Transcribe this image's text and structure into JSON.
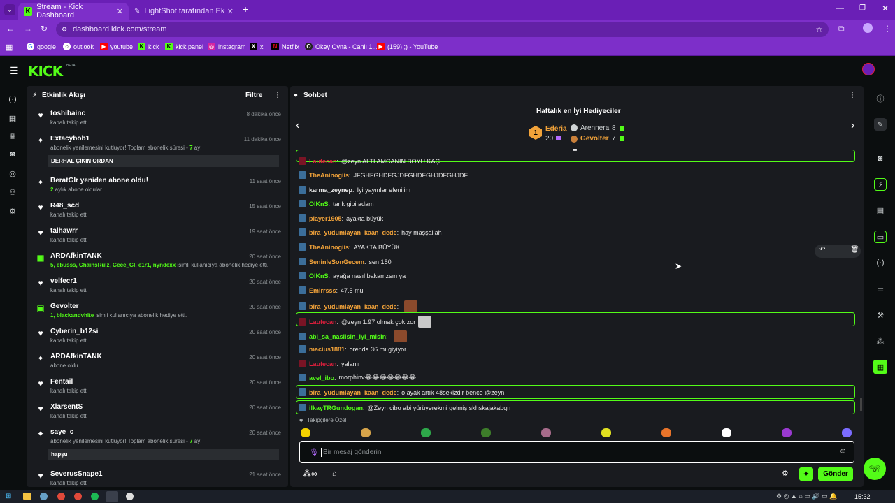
{
  "browser": {
    "tabs": [
      {
        "label": "Stream - Kick Dashboard",
        "active": true
      },
      {
        "label": "LightShot tarafından Ekran Gör",
        "active": false
      }
    ],
    "new_tab": "+",
    "url": "dashboard.kick.com/stream",
    "bookmarks": [
      {
        "label": "google"
      },
      {
        "label": "outlook"
      },
      {
        "label": "youtube"
      },
      {
        "label": "kick"
      },
      {
        "label": "kick panel"
      },
      {
        "label": "instagram"
      },
      {
        "label": "x"
      },
      {
        "label": "Netflix"
      },
      {
        "label": "Okey Oyna - Canlı 1..."
      },
      {
        "label": "(159) ;) - YouTube"
      }
    ]
  },
  "app": {
    "logo": "KICK",
    "logo_beta": "BETA"
  },
  "activity": {
    "title": "Etkinlik Akışı",
    "filter_label": "Filtre",
    "items": [
      {
        "name": "toshibainc",
        "sub": "kanalı takip etti",
        "time": "8 dakika önce",
        "icon": "heart-icon"
      },
      {
        "name": "Extacybob1",
        "sub_pre": "abonelik yenilemesini kutluyor! Toplam abonelik süresi - ",
        "sub_hl": "7",
        "sub_post": " ay!",
        "message": "DERHAL ÇIKIN ORDAN",
        "time": "11 dakika önce",
        "icon": "sparkle-icon"
      },
      {
        "name": "BeratGlr yeniden abone oldu!",
        "sub_hl": "2",
        "sub_post": " aylık abone oldular",
        "time": "11 saat önce",
        "icon": "sparkle-icon"
      },
      {
        "name": "R48_scd",
        "sub": "kanalı takip etti",
        "time": "15 saat önce",
        "icon": "heart-icon"
      },
      {
        "name": "talhawrr",
        "sub": "kanalı takip etti",
        "time": "19 saat önce",
        "icon": "heart-icon"
      },
      {
        "name": "ARDAfkinTANK",
        "sub_hl": "5, ebusss, ChainsRulz, Gece_Gl, e1r1, nyndexx",
        "sub_post": " isimli kullanıcıya abonelik hediye etti.",
        "time": "20 saat önce",
        "icon": "gift-icon"
      },
      {
        "name": "velfecr1",
        "sub": "kanalı takip etti",
        "time": "20 saat önce",
        "icon": "heart-icon"
      },
      {
        "name": "Gevolter",
        "sub_hl": "1, blackandvhite",
        "sub_post": " isimli kullanıcıya abonelik hediye etti.",
        "time": "20 saat önce",
        "icon": "gift-icon"
      },
      {
        "name": "Cyberin_b12si",
        "sub": "kanalı takip etti",
        "time": "20 saat önce",
        "icon": "heart-icon"
      },
      {
        "name": "ARDAfkinTANK",
        "sub": "abone oldu",
        "time": "20 saat önce",
        "icon": "sparkle-icon"
      },
      {
        "name": "Fentail",
        "sub": "kanalı takip etti",
        "time": "20 saat önce",
        "icon": "heart-icon"
      },
      {
        "name": "XlarsentS",
        "sub": "kanalı takip etti",
        "time": "20 saat önce",
        "icon": "heart-icon"
      },
      {
        "name": "saye_c",
        "sub_pre": "abonelik yenilemesini kutluyor! Toplam abonelik süresi - ",
        "sub_hl": "7",
        "sub_post": " ay!",
        "message": "hapşu",
        "time": "20 saat önce",
        "icon": "sparkle-icon"
      },
      {
        "name": "SeverusSnape1",
        "sub": "kanalı takip etti",
        "time": "21 saat önce",
        "icon": "heart-icon"
      }
    ]
  },
  "chat": {
    "title": "Sohbet",
    "gifters": {
      "title": "Haftalık en İyi Hediyeciler",
      "first": {
        "rank": "1",
        "name": "Ederia",
        "count": "20"
      },
      "second": {
        "name": "Arennera",
        "count": "8"
      },
      "third": {
        "name": "Gevolter",
        "count": "7"
      }
    },
    "messages": [
      {
        "user": "Lautecan",
        "text": "@zeyn ALTI AMCANIN BOYU KAÇ",
        "color": "#e01f3d",
        "boxed": true
      },
      {
        "user": "TheAninogiis",
        "text": "JFGHFGHDFGJDFGHDFGHJDFGHJDF",
        "color": "#f2a33a"
      },
      {
        "user": "karma_zeynep",
        "text": "İyi yayınlar efeniiim",
        "color": "#e6e6e6"
      },
      {
        "user": "OlKnS",
        "text": "tank gibi adam",
        "color": "#53fc18"
      },
      {
        "user": "player1905",
        "text": "ayakta büyük",
        "color": "#f2a33a"
      },
      {
        "user": "bira_yudumlayan_kaan_dede",
        "text": "hay maşşallah",
        "color": "#f2a33a"
      },
      {
        "user": "TheAninogiis",
        "text": "AYAKTA BÜYÜK",
        "color": "#f2a33a"
      },
      {
        "user": "SeninleSonGecem",
        "text": "sen 150",
        "color": "#f2a33a"
      },
      {
        "user": "OlKnS",
        "text": "ayağa nasıl bakamzsın ya",
        "color": "#53fc18"
      },
      {
        "user": "Emirrsss",
        "text": "47.5 mu",
        "color": "#f2a33a"
      },
      {
        "user": "bira_yudumlayan_kaan_dede",
        "text": "",
        "color": "#f2a33a"
      },
      {
        "user": "Lautecan",
        "text": "@zeyn 1.97 olmak çok zor",
        "color": "#e01f3d",
        "boxed": true
      },
      {
        "user": "abi_sa_nasilsin_iyi_misin",
        "text": "",
        "color": "#53fc18"
      },
      {
        "user": "macius1881",
        "text": "orenda 36 mı giyiyor",
        "color": "#f2a33a"
      },
      {
        "user": "Lautecan",
        "text": "yalanır",
        "color": "#e01f3d"
      },
      {
        "user": "avel_ibo",
        "text": "morphinv😂😂😂😂😂😂😂",
        "color": "#53fc18"
      },
      {
        "user": "bira_yudumlayan_kaan_dede",
        "text": "o ayak artık 48sekizdir bence @zeyn",
        "color": "#f2a33a",
        "boxed": true
      },
      {
        "user": "ilkayTRGundogan",
        "text": "@Zeyn cibo abi yürüyerekmi gelmiş skhskajakabqn",
        "color": "#53fc18",
        "boxed": true
      }
    ],
    "followers_only_label": "Takipçilere Özel",
    "input_placeholder": "Bir mesaj gönderin",
    "send_label": "Gönder"
  },
  "taskbar": {
    "time": "15:32"
  },
  "colors": {
    "accent": "#53fc18",
    "browser": "#7d2fc9",
    "panel": "#191b1f",
    "bg": "#0b0e0f"
  }
}
